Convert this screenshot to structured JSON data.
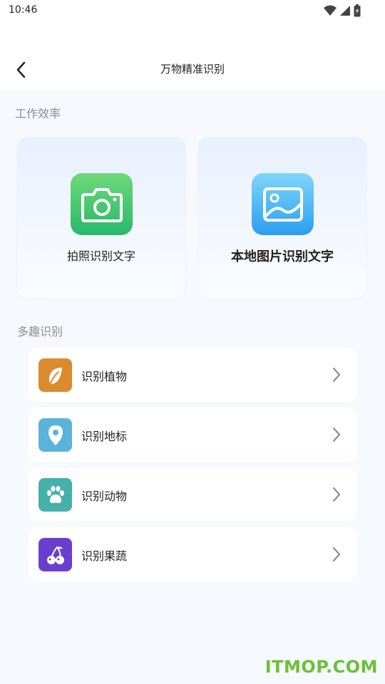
{
  "status": {
    "time": "10:46"
  },
  "header": {
    "title": "万物精准识别"
  },
  "work": {
    "title": "工作效率",
    "cards": [
      {
        "label": "拍照识别文字",
        "icon": "camera-icon",
        "color": "#2fbf6b"
      },
      {
        "label": "本地图片识别文字",
        "icon": "image-icon",
        "color": "#2a9ef0"
      }
    ]
  },
  "fun": {
    "title": "多趣识别",
    "items": [
      {
        "label": "识别植物",
        "icon": "leaf-icon",
        "color": "#dc8a2e"
      },
      {
        "label": "识别地标",
        "icon": "location-pin-icon",
        "color": "#5ab3d9"
      },
      {
        "label": "识别动物",
        "icon": "paw-icon",
        "color": "#47b0aa"
      },
      {
        "label": "识别果蔬",
        "icon": "cherry-icon",
        "color": "#6a3fcf"
      }
    ]
  },
  "watermark": "ITMOP.COM"
}
